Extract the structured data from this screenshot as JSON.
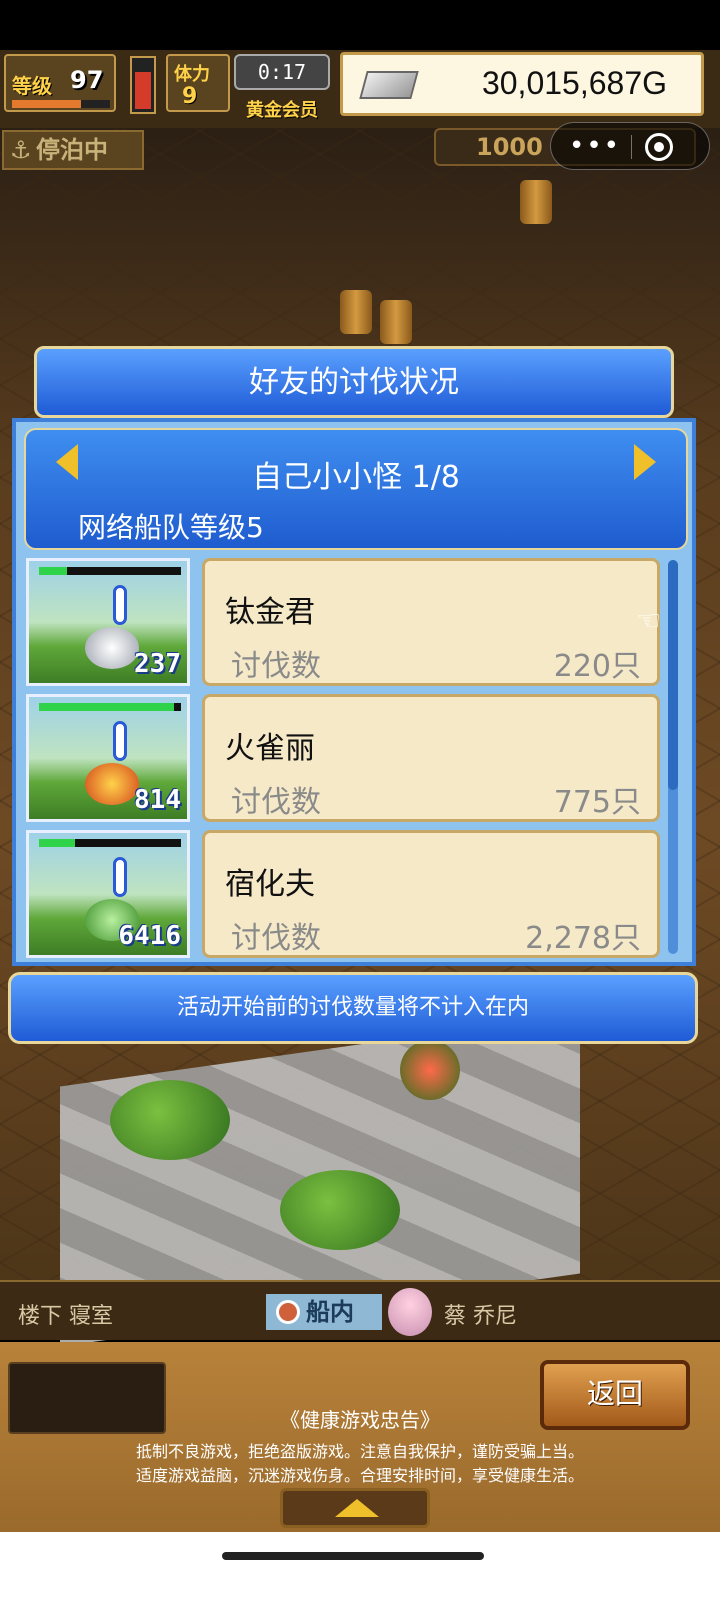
{
  "status": {
    "level_label": "等级",
    "level_value": "97",
    "level_progress": 0.7,
    "stamina_bar_fraction": 0.75,
    "stamina_label": "体力",
    "stamina_value": "9",
    "timer": "0:17",
    "membership": "黄金会员",
    "money": "30,015,687G",
    "dock_status": "停泊中",
    "resource_value": "1000"
  },
  "mini_program": {
    "more_icon": "more-dots-icon",
    "close_icon": "close-circle-icon"
  },
  "dialog": {
    "title": "好友的讨伐状况",
    "header_title": "自己小小怪 1/8",
    "header_sub": "网络船队等级5",
    "rows": [
      {
        "thumb_num": "237",
        "name": "钛金君",
        "label": "讨伐数",
        "count": "220只",
        "hp": 0.2,
        "monster": "white-beast"
      },
      {
        "thumb_num": "814",
        "name": "火雀丽",
        "label": "讨伐数",
        "count": "775只",
        "hp": 0.95,
        "monster": "fire-bird"
      },
      {
        "thumb_num": "6416",
        "name": "宿化夫",
        "label": "讨伐数",
        "count": "2,278只",
        "hp": 0.25,
        "monster": "green-beast"
      }
    ],
    "notice": "活动开始前的讨伐数量将不计入在内"
  },
  "location": {
    "left": "楼下 寝室",
    "center": "船内",
    "right": "蔡 乔尼"
  },
  "bottom": {
    "back_label": "返回",
    "advisory_title": "《健康游戏忠告》",
    "advisory_line1": "抵制不良游戏，拒绝盗版游戏。注意自我保护，谨防受骗上当。",
    "advisory_line2": "适度游戏益脑，沉迷游戏伤身。合理安排时间，享受健康生活。"
  },
  "colors": {
    "dialog_blue": "#1f5bd6",
    "card_bg": "#f6e9c8",
    "gold": "#f0c02a"
  }
}
